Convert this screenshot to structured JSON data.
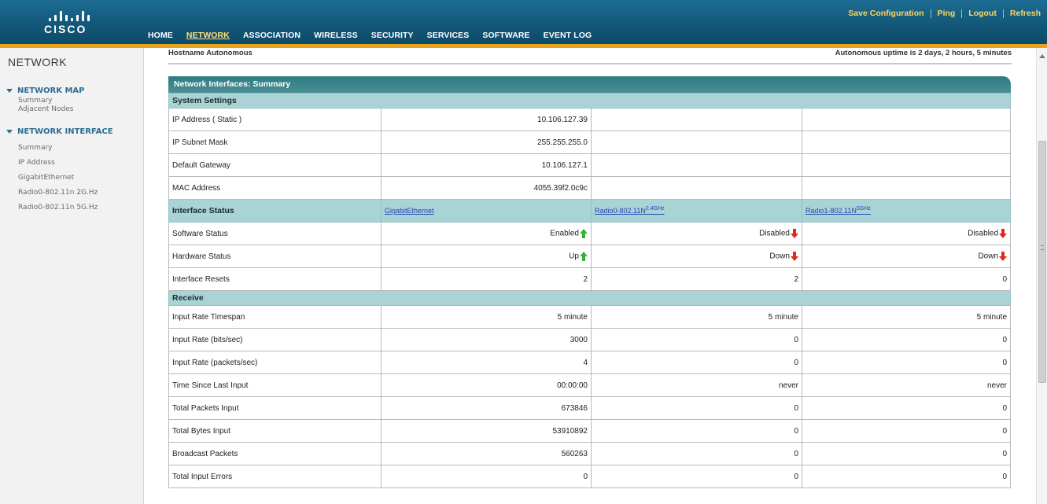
{
  "header": {
    "logo_text": "cisco",
    "utility_links": [
      "Save Configuration",
      "Ping",
      "Logout",
      "Refresh"
    ],
    "nav": [
      {
        "label": "HOME",
        "active": false
      },
      {
        "label": "NETWORK",
        "active": true
      },
      {
        "label": "ASSOCIATION",
        "active": false
      },
      {
        "label": "WIRELESS",
        "active": false
      },
      {
        "label": "SECURITY",
        "active": false
      },
      {
        "label": "SERVICES",
        "active": false
      },
      {
        "label": "SOFTWARE",
        "active": false
      },
      {
        "label": "EVENT LOG",
        "active": false
      }
    ],
    "accent_color": "#e7a21b",
    "bar_color": "#135879"
  },
  "sidebar": {
    "title": "NETWORK",
    "groups": [
      {
        "label": "NETWORK MAP",
        "items": [
          "Summary",
          "Adjacent Nodes"
        ]
      },
      {
        "label": "NETWORK INTERFACE",
        "items": [
          "Summary",
          "IP Address",
          "GigabitEthernet",
          "Radio0-802.11n 2G.Hz",
          "Radio0-802.11n 5G.Hz"
        ]
      }
    ]
  },
  "content": {
    "hostname_label": "Hostname",
    "hostname_value": "Autonomous",
    "uptime": "Autonomous uptime is 2 days, 2 hours, 5 minutes",
    "panel_title": "Network Interfaces: Summary",
    "system_settings": {
      "title": "System Settings",
      "rows": [
        {
          "label": "IP Address ( Static )",
          "value": "10.106.127.39"
        },
        {
          "label": "IP Subnet Mask",
          "value": "255.255.255.0"
        },
        {
          "label": "Default Gateway",
          "value": "10.106.127.1"
        },
        {
          "label": "MAC Address",
          "value": "4055.39f2.0c9c"
        }
      ]
    },
    "interface_status": {
      "title": "Interface Status",
      "columns": [
        {
          "label": "GigabitEthernet",
          "sup": ""
        },
        {
          "label": "Radio0-802.11N",
          "sup": "2.4GHz"
        },
        {
          "label": "Radio1-802.11N",
          "sup": "5GHz"
        }
      ],
      "rows": [
        {
          "label": "Software Status",
          "values": [
            "Enabled",
            "Disabled",
            "Disabled"
          ],
          "arrows": [
            "up",
            "down",
            "down"
          ]
        },
        {
          "label": "Hardware Status",
          "values": [
            "Up",
            "Down",
            "Down"
          ],
          "arrows": [
            "up",
            "down",
            "down"
          ]
        },
        {
          "label": "Interface Resets",
          "values": [
            "2",
            "2",
            "0"
          ],
          "arrows": [
            "",
            "",
            ""
          ]
        }
      ]
    },
    "receive": {
      "title": "Receive",
      "rows": [
        {
          "label": "Input Rate Timespan",
          "values": [
            "5 minute",
            "5 minute",
            "5 minute"
          ]
        },
        {
          "label": "Input Rate (bits/sec)",
          "values": [
            "3000",
            "0",
            "0"
          ]
        },
        {
          "label": "Input Rate (packets/sec)",
          "values": [
            "4",
            "0",
            "0"
          ]
        },
        {
          "label": "Time Since Last Input",
          "values": [
            "00:00:00",
            "never",
            "never"
          ]
        },
        {
          "label": "Total Packets Input",
          "values": [
            "673846",
            "0",
            "0"
          ]
        },
        {
          "label": "Total Bytes Input",
          "values": [
            "53910892",
            "0",
            "0"
          ]
        },
        {
          "label": "Broadcast Packets",
          "values": [
            "560263",
            "0",
            "0"
          ]
        },
        {
          "label": "Total Input Errors",
          "values": [
            "0",
            "0",
            "0"
          ]
        }
      ]
    }
  }
}
